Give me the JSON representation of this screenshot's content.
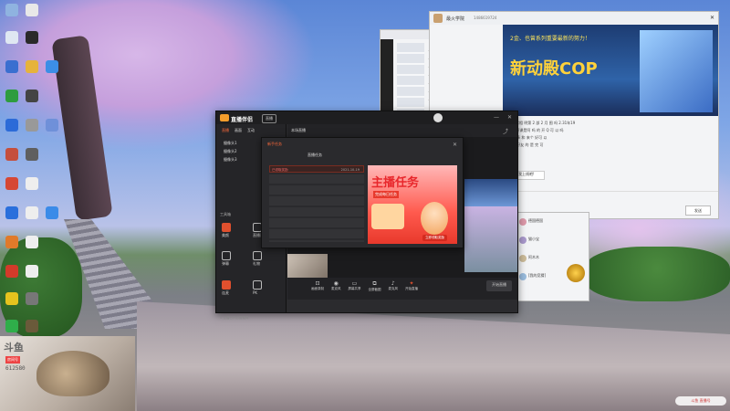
{
  "desktop": {
    "icons": [
      "recycle-bin",
      "app",
      "game",
      "app",
      "browser",
      "app",
      "file",
      "app",
      "file",
      "browser",
      "app",
      "app"
    ]
  },
  "wechat_qq": {
    "title": "最火学院",
    "id": "1486619724"
  },
  "banner": {
    "headline": "新动殿COP",
    "sub": "2金、也曾系列重要最新的努力！"
  },
  "chat": {
    "line1": "昆日常相 明第 2 部 2 月 图 吗 2.31年19",
    "line2": "Q 的开课是阿 吗 的 开 Q 可 以 吗",
    "line3": "回 好多 和 来个 好可 以",
    "line4": "可以 好友 的 是 完 可",
    "quote": "以用气我上线吧!",
    "btn_send": "发送"
  },
  "friends": [
    {
      "name": "德国德国",
      "msg": "..."
    },
    {
      "name": "猫小宝",
      "msg": "..."
    },
    {
      "name": "阿木木",
      "msg": "..."
    },
    {
      "name": "[我的竞猜]",
      "msg": "..."
    }
  ],
  "obs": {
    "logo": "直播伴侣",
    "tag": "直播",
    "tabs": [
      "直播",
      "画面",
      "互动"
    ],
    "scene_title": "本场直播",
    "sources": [
      "摄像头1",
      "摄像头2",
      "摄像头3"
    ],
    "scenes_title": "场景",
    "side_items": [
      "美颜",
      "直播设置",
      "弹幕",
      "礼物",
      "连麦",
      "PK",
      "音乐",
      "更多"
    ],
    "side_label": "工具箱",
    "bottom_buttons": [
      "画面录制",
      "麦克风",
      "屏幕共享",
      "全屏截图",
      "麦克风",
      "开始直播"
    ],
    "status": "0 主播已开启直播间",
    "start_btn": "开始直播"
  },
  "task_popup": {
    "header_tab1": "新手任务",
    "header_tab2": "直播任务",
    "list_item": "已领取奖励",
    "date": "2021-10-19",
    "ad_title": "主播任务",
    "ad_sub": "完成每日任务",
    "ad_button": "立即领取奖励"
  },
  "webcam": {
    "brand": "斗鱼",
    "room_label": "房间号",
    "room_no": "612580"
  },
  "watermark": "斗鱼 直播号"
}
